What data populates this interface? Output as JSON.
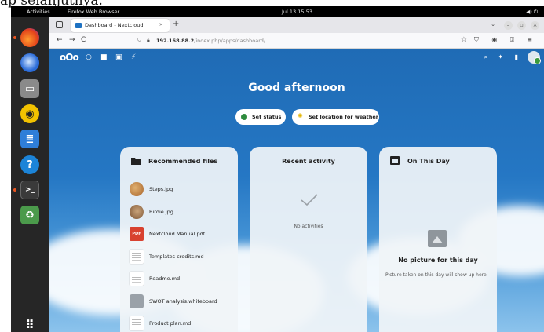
{
  "caption": "ap selanjutnya.",
  "system_bar": {
    "activities": "Activities",
    "app_name": "Firefox Web Browser",
    "clock": "Jul 13  15:53",
    "tray": "◀) ⏻"
  },
  "dock": {
    "apps": [
      "firefox",
      "thunderbird",
      "files",
      "rhythmbox",
      "libreoffice-writer",
      "help",
      "terminal",
      "trash",
      "show-applications"
    ]
  },
  "browser": {
    "tab_title": "Dashboard - Nextcloud",
    "tab_close": "×",
    "new_tab": "+",
    "tab_list": "⌄",
    "back": "←",
    "forward": "→",
    "reload": "C",
    "url_host": "192.168.88.2",
    "url_path": "/index.php/apps/dashboard/",
    "bookmark_star": "☆",
    "window_controls": [
      "–",
      "▫",
      "×"
    ],
    "toolbar_icons": "⛉ ◉ ⍗ ≡"
  },
  "nextcloud": {
    "logo": "oOo",
    "header_apps": [
      "○",
      "■",
      "▣",
      "⚡"
    ],
    "header_right": [
      "⌕",
      "✦",
      "▮"
    ],
    "greeting": "Good afternoon",
    "set_status": "Set status",
    "set_weather": "Set location for weather",
    "panels": {
      "recommended": {
        "title": "Recommended files",
        "files": [
          {
            "name": "Steps.jpg",
            "kind": "photo1"
          },
          {
            "name": "Birdie.jpg",
            "kind": "photo2"
          },
          {
            "name": "Nextcloud Manual.pdf",
            "kind": "pdf",
            "badge": "PDF"
          },
          {
            "name": "Templates credits.md",
            "kind": "doc"
          },
          {
            "name": "Readme.md",
            "kind": "doc"
          },
          {
            "name": "SWOT analysis.whiteboard",
            "kind": "board"
          },
          {
            "name": "Product plan.md",
            "kind": "doc"
          }
        ]
      },
      "activity": {
        "title": "Recent activity",
        "empty_text": "No activities"
      },
      "onthisday": {
        "title": "On This Day",
        "empty_title": "No picture for this day",
        "empty_sub": "Picture taken on this day will show up here."
      }
    }
  }
}
